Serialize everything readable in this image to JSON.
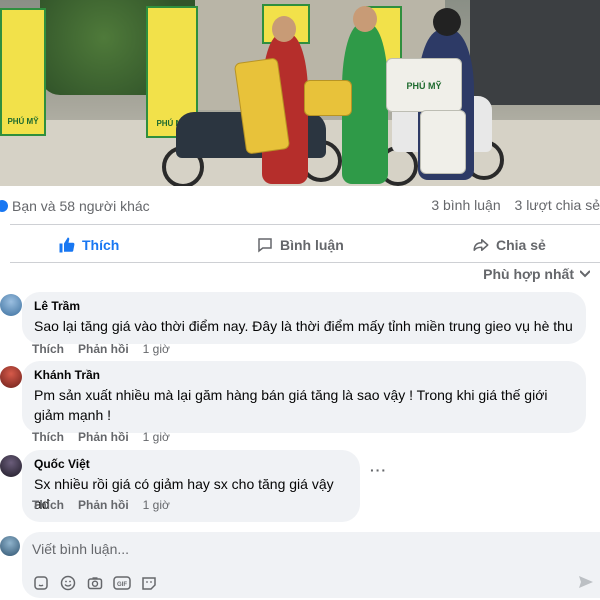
{
  "post": {
    "photo": {
      "banner_text": "PHÚ MỸ",
      "bag_text": "PHÚ MỸ"
    },
    "stats": {
      "reactions_text": "Bạn và 58 người khác",
      "comments_count": "3 bình luận",
      "shares_count": "3 lượt chia sẻ"
    },
    "actions": {
      "like": "Thích",
      "comment": "Bình luận",
      "share": "Chia sẻ"
    },
    "sort_label": "Phù hợp nhất"
  },
  "comments": [
    {
      "author": "Lê Trầm",
      "text_lines": [
        "Sao lại tăng giá vào thời điểm nay. Đây là thời điểm mấy tỉnh miền trung gieo vụ hè thu"
      ],
      "like": "Thích",
      "reply": "Phản hồi",
      "time": "1 giờ"
    },
    {
      "author": "Khánh Trần",
      "text_lines": [
        "Pm sản xuất nhiều mà lại găm hàng bán giá tăng là sao vậy ! Trong khi giá thế giới",
        "giảm mạnh !"
      ],
      "like": "Thích",
      "reply": "Phản hồi",
      "time": "1 giờ"
    },
    {
      "author": "Quốc Việt",
      "text_lines": [
        "Sx nhiều rồi giá có giảm hay sx cho tăng giá vậy ad"
      ],
      "like": "Thích",
      "reply": "Phản hồi",
      "time": "1 giờ",
      "more": "···"
    }
  ],
  "write_comment": {
    "placeholder": "Viết bình luận...",
    "tools": [
      "sticker-icon",
      "emoji-icon",
      "camera-icon",
      "gif-icon",
      "avatar-sticker-icon"
    ]
  },
  "colors": {
    "accent": "#1877f2",
    "secondary_text": "#65676b",
    "bubble": "#f0f2f5"
  }
}
